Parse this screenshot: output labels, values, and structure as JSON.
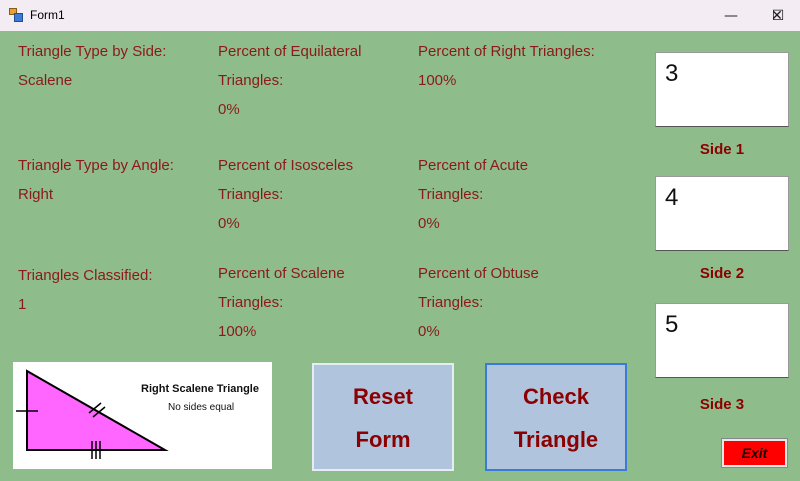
{
  "window": {
    "title": "Form1",
    "min_glyph": "—",
    "max_glyph": "☐",
    "close_glyph": "✕"
  },
  "labels": {
    "type_by_side_title": "Triangle Type by Side:",
    "type_by_side_value": "Scalene",
    "type_by_angle_title": "Triangle Type by Angle:",
    "type_by_angle_value": "Right",
    "classified_title": "Triangles Classified:",
    "classified_value": "1",
    "pct_equilateral_1": "Percent of Equilateral",
    "pct_equilateral_2": "Triangles:",
    "pct_equilateral_value": "0%",
    "pct_isosceles_1": "Percent of Isosceles",
    "pct_isosceles_2": "Triangles:",
    "pct_isosceles_value": "0%",
    "pct_scalene_1": "Percent of Scalene",
    "pct_scalene_2": "Triangles:",
    "pct_scalene_value": "100%",
    "pct_right_1": "Percent of Right Triangles:",
    "pct_right_value": "100%",
    "pct_acute_1": "Percent of Acute",
    "pct_acute_2": "Triangles:",
    "pct_acute_value": "0%",
    "pct_obtuse_1": "Percent of Obtuse",
    "pct_obtuse_2": "Triangles:",
    "pct_obtuse_value": "0%"
  },
  "sides": [
    {
      "value": "3",
      "label": "Side 1"
    },
    {
      "value": "4",
      "label": "Side 2"
    },
    {
      "value": "5",
      "label": "Side 3"
    }
  ],
  "buttons": {
    "reset_line1": "Reset",
    "reset_line2": "Form",
    "check_line1": "Check",
    "check_line2": "Triangle",
    "exit": "Exit"
  },
  "diagram": {
    "title": "Right Scalene Triangle",
    "subtitle": "No sides equal",
    "fill_color": "#ff66ff"
  },
  "colors": {
    "form_background": "#8fbc8b",
    "label_text": "#8b1a1a",
    "button_background": "#b0c4de",
    "exit_background": "#ff0000"
  }
}
